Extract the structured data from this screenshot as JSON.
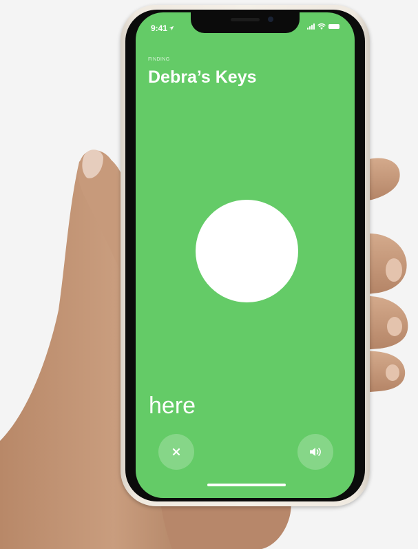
{
  "status_bar": {
    "time": "9:41",
    "icons": [
      "location-arrow-icon",
      "cellular-signal-icon",
      "wifi-icon",
      "battery-icon"
    ]
  },
  "finding": {
    "label": "FINDING",
    "item_name": "Debra’s Keys"
  },
  "direction": {
    "text": "here"
  },
  "controls": {
    "close_icon": "close-icon",
    "sound_icon": "speaker-icon"
  },
  "colors": {
    "screen_green": "#64cb67",
    "target": "#ffffff",
    "phone_frame": "#efe9e0",
    "background": "#f4f4f4",
    "skin": "#c99d7e"
  }
}
